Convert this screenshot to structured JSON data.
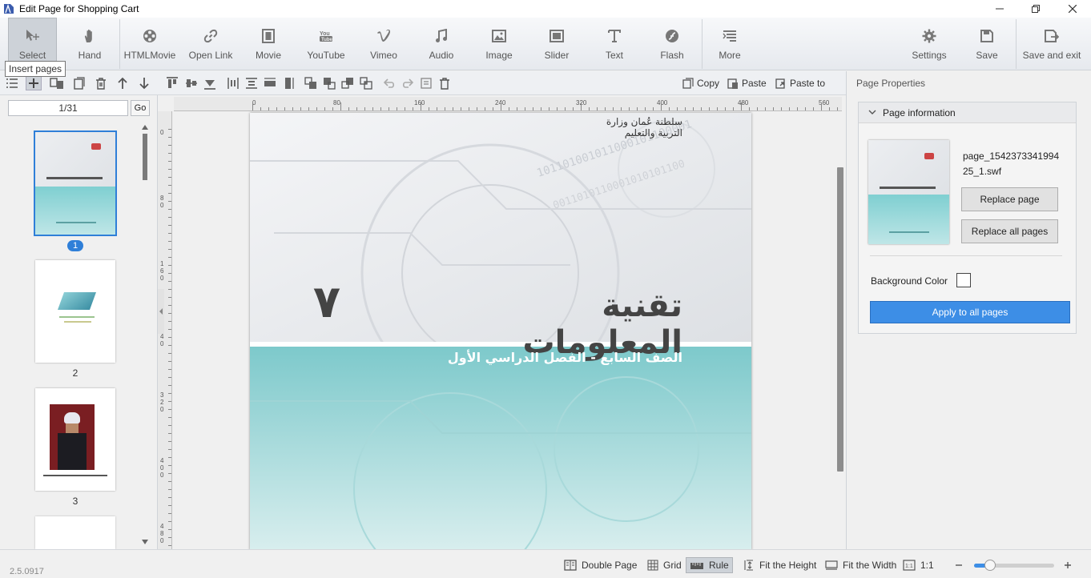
{
  "window": {
    "title": "Edit Page for Shopping Cart",
    "controls": [
      "minimize",
      "restore",
      "close"
    ]
  },
  "toolbar": {
    "buttons": [
      {
        "label": "Select",
        "icon": "select-arrow-icon",
        "active": true
      },
      {
        "label": "Hand",
        "icon": "hand-icon"
      },
      {
        "label": "HTMLMovie",
        "icon": "film-reel-icon"
      },
      {
        "label": "Open Link",
        "icon": "link-icon"
      },
      {
        "label": "Movie",
        "icon": "movie-icon"
      },
      {
        "label": "YouTube",
        "icon": "youtube-icon"
      },
      {
        "label": "Vimeo",
        "icon": "vimeo-icon"
      },
      {
        "label": "Audio",
        "icon": "music-note-icon"
      },
      {
        "label": "Image",
        "icon": "image-icon"
      },
      {
        "label": "Slider",
        "icon": "slider-icon"
      },
      {
        "label": "Text",
        "icon": "text-icon"
      },
      {
        "label": "Flash",
        "icon": "flash-icon"
      },
      {
        "label": "More",
        "icon": "more-icon"
      },
      {
        "label": "Settings",
        "icon": "gear-icon"
      },
      {
        "label": "Save",
        "icon": "save-icon"
      },
      {
        "label": "Save and exit",
        "icon": "save-exit-icon"
      }
    ],
    "tooltip": "Insert pages"
  },
  "subtoolbar": {
    "copy": "Copy",
    "paste": "Paste",
    "paste_to": "Paste to"
  },
  "thumbnails": {
    "page_input": "1/31",
    "go": "Go",
    "pages": [
      {
        "number": "1",
        "selected": true
      },
      {
        "number": "2"
      },
      {
        "number": "3"
      }
    ]
  },
  "ruler": {
    "h_ticks": [
      "0",
      "80",
      "160",
      "240",
      "320",
      "400",
      "480",
      "560"
    ],
    "v_ticks": [
      "0",
      "80",
      "160",
      "240",
      "320",
      "400",
      "480"
    ]
  },
  "page": {
    "header_text": "سلطنة عُمان وزارة التربية والتعليم",
    "title": "تقنية المعلومات",
    "number": "٧",
    "subtitle": "الصف السابع - الفصل الدراسي الأول"
  },
  "properties": {
    "panel_title": "Page Properties",
    "section_title": "Page information",
    "filename": "page_1542373341994 25_1.swf",
    "replace_page": "Replace page",
    "replace_all": "Replace all pages",
    "bg_label": "Background Color",
    "bg_color": "#ffffff",
    "apply_all": "Apply to all pages"
  },
  "statusbar": {
    "double_page": "Double Page",
    "grid": "Grid",
    "rule": "Rule",
    "fit_height": "Fit the Height",
    "fit_width": "Fit the Width",
    "one_to_one": "1:1",
    "zoom_level": 0.2,
    "version": "2.5.0917"
  },
  "colors": {
    "accent": "#3d8ee6",
    "teal": "#7dc7c9"
  }
}
